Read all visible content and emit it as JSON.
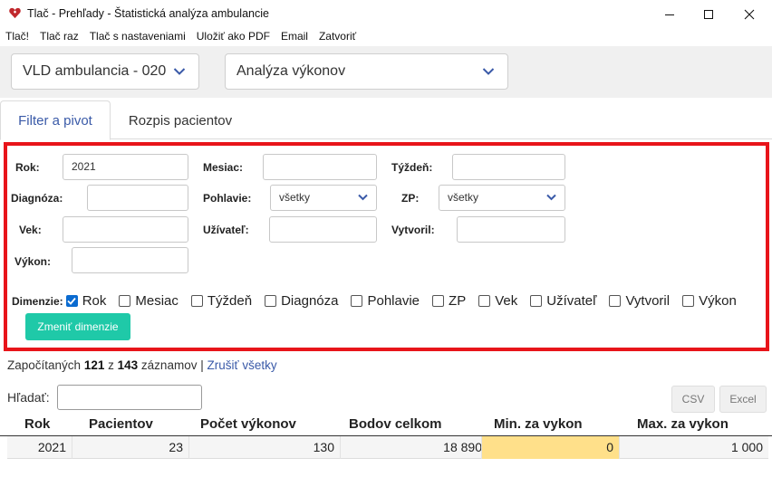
{
  "window": {
    "title": "Tlač - Prehľady - Štatistická analýza ambulancie",
    "accent": "#c0282d"
  },
  "menu": {
    "items": [
      "Tlač!",
      "Tlač raz",
      "Tlač s nastaveniami",
      "Uložiť ako PDF",
      "Email",
      "Zatvoriť"
    ]
  },
  "selectors": {
    "ambulance": "VLD ambulancia - 020",
    "analysis": "Analýza výkonov"
  },
  "tabs": [
    {
      "label": "Filter a pivot",
      "active": true
    },
    {
      "label": "Rozpis pacientov",
      "active": false
    }
  ],
  "filter": {
    "rok_label": "Rok:",
    "rok_value": "2021",
    "mesiac_label": "Mesiac:",
    "mesiac_value": "",
    "tyzden_label": "Týždeň:",
    "tyzden_value": "",
    "diagnoza_label": "Diagnóza:",
    "diagnoza_value": "",
    "pohlavie_label": "Pohlavie:",
    "pohlavie_value": "všetky",
    "zp_label": "ZP:",
    "zp_value": "všetky",
    "vek_label": "Vek:",
    "vek_value": "",
    "uzivatel_label": "Užívateľ:",
    "uzivatel_value": "",
    "vytvoril_label": "Vytvoril:",
    "vytvoril_value": "",
    "vykon_label": "Výkon:",
    "vykon_value": "",
    "dimensions_label": "Dimenzie:",
    "dimensions": [
      {
        "label": "Rok",
        "checked": true
      },
      {
        "label": "Mesiac",
        "checked": false
      },
      {
        "label": "Týždeň",
        "checked": false
      },
      {
        "label": "Diagnóza",
        "checked": false
      },
      {
        "label": "Pohlavie",
        "checked": false
      },
      {
        "label": "ZP",
        "checked": false
      },
      {
        "label": "Vek",
        "checked": false
      },
      {
        "label": "Užívateľ",
        "checked": false
      },
      {
        "label": "Vytvoril",
        "checked": false
      },
      {
        "label": "Výkon",
        "checked": false
      }
    ],
    "change_button": "Zmeniť dimenzie",
    "highlight_color": "#e8141a",
    "button_color": "#1fc9a8"
  },
  "counts": {
    "prefix": "Započítaných",
    "counted": "121",
    "of": "z",
    "total": "143",
    "suffix": "záznamov",
    "separator": "|",
    "clear_link": "Zrušiť všetky"
  },
  "search": {
    "label": "Hľadať:",
    "value": ""
  },
  "export": {
    "csv": "CSV",
    "excel": "Excel"
  },
  "table": {
    "columns": [
      "Rok",
      "Pacientov",
      "Počet výkonov",
      "Bodov celkom",
      "Min. za vykon",
      "Max. za vykon"
    ],
    "rows": [
      [
        "2021",
        "23",
        "130",
        "18 890",
        "0",
        "1 000"
      ]
    ],
    "highlight_cell_color": "#ffe08a"
  }
}
